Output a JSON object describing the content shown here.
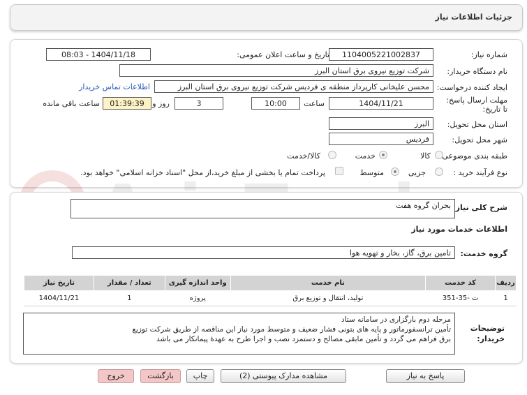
{
  "page": {
    "title": "جزئیات اطلاعات نیاز"
  },
  "details": {
    "need_number_label": "شماره نیاز:",
    "need_number": "1104005221002837",
    "announce_label": "تاریخ و ساعت اعلان عمومی:",
    "announce_value": "1404/11/18 - 08:03",
    "buyer_org_label": "نام دستگاه خریدار:",
    "buyer_org": "شرکت توزیع نیروی برق استان البرز",
    "creator_label": "ایجاد کننده درخواست:",
    "creator": "محسن علیخانی کارپرداز منطقه ی فردیس شرکت توزیع نیروی برق استان البرز",
    "contact_link": "اطلاعات تماس خریدار",
    "deadline_label": "مهلت ارسال پاسخ: تا تاریخ:",
    "deadline_date": "1404/11/21",
    "time_label": "ساعت",
    "deadline_time": "10:00",
    "days_value": "3",
    "days_label": "روز و",
    "remaining_time": "01:39:39",
    "remaining_label": "ساعت باقی مانده",
    "province_label": "استان محل تحویل:",
    "province": "البرز",
    "city_label": "شهر محل تحویل:",
    "city": "فردیس",
    "category_label": "طبقه بندی موضوعی:",
    "category_options": [
      "کالا",
      "خدمت",
      "کالا/خدمت"
    ],
    "process_label": "نوع فرآیند خرید :",
    "process_options": [
      "جزیی",
      "متوسط"
    ],
    "payment_note": "پرداخت تمام یا بخشی از مبلغ خرید،از محل \"اسناد خزانه اسلامی\" خواهد بود."
  },
  "summary": {
    "label": "شرح کلی نیاز:",
    "value": "بحران گروه هفت"
  },
  "services": {
    "heading": "اطلاعات خدمات مورد نیاز",
    "group_label": "گروه خدمت:",
    "group_value": "تامین برق، گاز، بخار و تهویه هوا",
    "columns": [
      "ردیف",
      "کد خدمت",
      "نام خدمت",
      "واحد اندازه گیری",
      "تعداد / مقدار",
      "تاریخ نیاز"
    ],
    "rows": [
      [
        "1",
        "ت -35-351",
        "تولید، انتقال و توزیع برق",
        "پروژه",
        "1",
        "1404/11/21"
      ]
    ]
  },
  "buyer_notes": {
    "label": "توضیحات خریدار:",
    "lines": [
      "مرحله دوم بارگزاری در سامانه ستاد",
      "تأمین ترانسفورماتور و پایه های بتونی فشار ضعیف و متوسط مورد نیاز این مناقصه از طریق شرکت توزیع",
      "برق فراهم می گردد و تأمین مابقی مصالح و دستمزد نصب و اجرا طرح به عهدهٔ پیمانکار می باشد"
    ]
  },
  "buttons": {
    "reply": "پاسخ به نیاز",
    "attachments": "مشاهده مدارک پیوستی (2)",
    "print": "چاپ",
    "back": "بازگشت",
    "exit": "خروج"
  },
  "colors": {
    "highlight": "#fdf3c4",
    "link": "#2457b8",
    "table_header": "#d3d3d3",
    "pink_button": "#f3c7c7"
  }
}
